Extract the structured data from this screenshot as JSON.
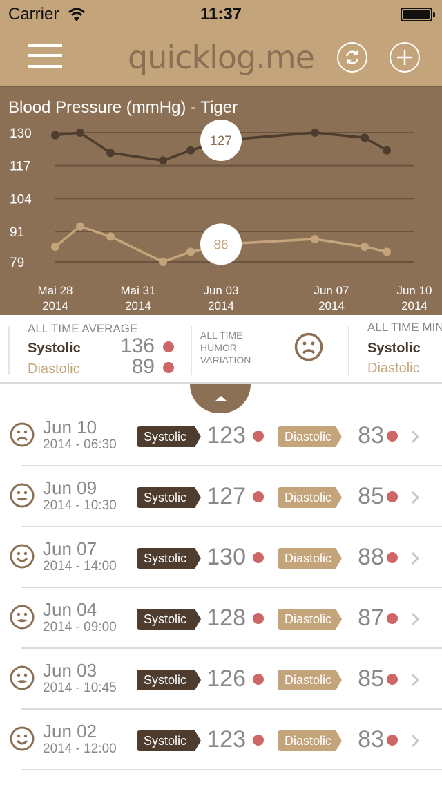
{
  "status_bar": {
    "carrier": "Carrier",
    "time": "11:37"
  },
  "nav": {
    "logo": "quicklog.me",
    "menu_icon": "hamburger-menu-icon",
    "refresh_icon": "refresh-icon",
    "add_icon": "plus-icon"
  },
  "colors": {
    "nav_bg": "#c4a47a",
    "chart_bg": "#8b7055",
    "systolic": "#4e3d2e",
    "diastolic": "#c4a47a",
    "alert_dot": "#cf6666"
  },
  "chart_data": {
    "type": "line",
    "title": "Blood Pressure (mmHg) - Tiger",
    "y_ticks": [
      "130",
      "117",
      "104",
      "91",
      "79"
    ],
    "ylim": [
      79,
      130
    ],
    "x_tick_labels": [
      {
        "month_day": "Mai 28",
        "year": "2014"
      },
      {
        "month_day": "Mai 31",
        "year": "2014"
      },
      {
        "month_day": "Jun 03",
        "year": "2014"
      },
      {
        "month_day": "Jun 07",
        "year": "2014"
      },
      {
        "month_day": "Jun 10",
        "year": "2014"
      }
    ],
    "x_day_range": [
      0,
      13
    ],
    "grid": true,
    "series": [
      {
        "name": "Systolic",
        "points": [
          {
            "day": 0,
            "value": 129
          },
          {
            "day": 0.9,
            "value": 130
          },
          {
            "day": 2,
            "value": 122
          },
          {
            "day": 3.9,
            "value": 119
          },
          {
            "day": 4.9,
            "value": 123
          },
          {
            "day": 5.8,
            "value": 126
          },
          {
            "day": 6,
            "value": 127
          },
          {
            "day": 9.4,
            "value": 130
          },
          {
            "day": 11.2,
            "value": 128
          },
          {
            "day": 12,
            "value": 123
          }
        ],
        "highlight": {
          "day": 6,
          "value": 127,
          "label": "127"
        }
      },
      {
        "name": "Diastolic",
        "points": [
          {
            "day": 0,
            "value": 85
          },
          {
            "day": 0.9,
            "value": 93
          },
          {
            "day": 2,
            "value": 89
          },
          {
            "day": 3.9,
            "value": 79
          },
          {
            "day": 4.9,
            "value": 83
          },
          {
            "day": 5.8,
            "value": 85
          },
          {
            "day": 6,
            "value": 86
          },
          {
            "day": 9.4,
            "value": 88
          },
          {
            "day": 11.2,
            "value": 85
          },
          {
            "day": 12,
            "value": 83
          }
        ],
        "highlight": {
          "day": 6,
          "value": 86,
          "label": "86"
        }
      }
    ]
  },
  "stats": {
    "average": {
      "heading": "ALL TIME AVERAGE",
      "systolic_label": "Systolic",
      "systolic_value": "136",
      "diastolic_label": "Diastolic",
      "diastolic_value": "89"
    },
    "humor": {
      "heading_line1": "ALL TIME",
      "heading_line2": "HUMOR",
      "heading_line3": "VARIATION",
      "face": "sad"
    },
    "minimum": {
      "heading": "ALL TIME MIN",
      "systolic_label": "Systolic",
      "diastolic_label": "Diastolic"
    }
  },
  "entries_labels": {
    "systolic": "Systolic",
    "diastolic": "Diastolic"
  },
  "entries": [
    {
      "date": "Jun 10",
      "time": "2014 - 06:30",
      "mood": "sad",
      "systolic": "123",
      "diastolic": "83"
    },
    {
      "date": "Jun 09",
      "time": "2014 - 10:30",
      "mood": "neutral",
      "systolic": "127",
      "diastolic": "85"
    },
    {
      "date": "Jun 07",
      "time": "2014 - 14:00",
      "mood": "happy",
      "systolic": "130",
      "diastolic": "88"
    },
    {
      "date": "Jun 04",
      "time": "2014 - 09:00",
      "mood": "neutral",
      "systolic": "128",
      "diastolic": "87"
    },
    {
      "date": "Jun 03",
      "time": "2014 - 10:45",
      "mood": "neutral",
      "systolic": "126",
      "diastolic": "85"
    },
    {
      "date": "Jun 02",
      "time": "2014 - 12:00",
      "mood": "happy",
      "systolic": "123",
      "diastolic": "83"
    }
  ]
}
